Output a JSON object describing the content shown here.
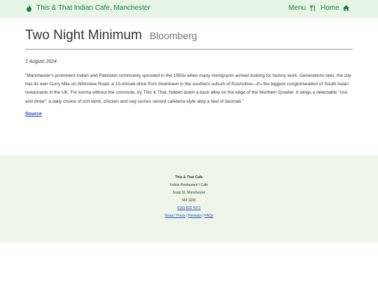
{
  "nav": {
    "brand": "This & That Indian Cafe, Manchester",
    "menu_label": "Menu",
    "home_label": "Home"
  },
  "article": {
    "title": "Two Night Minimum",
    "source_name": "Bloomberg",
    "date": "1 August 2024",
    "quote": "\"Manchester's prominent Indian and Pakistani community sprouted in the 1950s when many immigrants arrived looking for factory work. Generations later, the city has its own Curry Mile on Wilmslow Road, a 15-minute drive from downtown in the southern suburb of Rusholme—it's the biggest conglomeration of South Asian restaurants in the UK. For korma without the commute, try This & That, hidden down a back alley on the edge of the Northern Quarter. It slings a delectable \"rice and three\": a daily choice of rich lamb, chicken and veg curries served cafeteria-style atop a bed of basmati.\"",
    "source_link": "Source"
  },
  "footer": {
    "name": "This & That Cafe",
    "type": "Indian Restaurant / Cafe",
    "street": "Soap St, Manchester",
    "postcode": "M4 1EW",
    "phone": "0161 832 4971",
    "links": [
      "News / Press",
      "Reviews",
      "FAQs"
    ],
    "separator": " / "
  },
  "colors": {
    "nav_bg": "#e6f5e6",
    "nav_text": "#1a7a3a",
    "link": "#1f4fb3",
    "footer_bg": "#eef6ea"
  },
  "icons": {
    "brand": "fire-icon",
    "menu": "utensils-icon",
    "home": "home-icon"
  }
}
